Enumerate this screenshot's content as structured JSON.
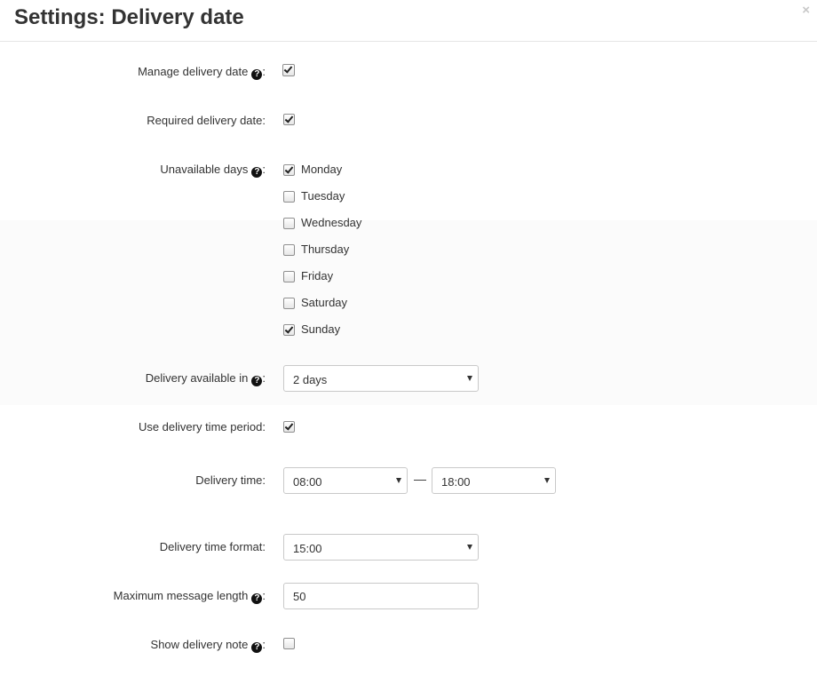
{
  "dialog": {
    "title": "Settings: Delivery date",
    "close_symbol": "×"
  },
  "help_icon_glyph": "?",
  "colon": ":",
  "fields": {
    "manage_delivery_date": {
      "label": "Manage delivery date",
      "checked": true
    },
    "required_delivery_date": {
      "label": "Required delivery date:",
      "checked": true
    },
    "unavailable_days": {
      "label": "Unavailable days",
      "days": [
        {
          "label": "Monday",
          "checked": true
        },
        {
          "label": "Tuesday",
          "checked": false
        },
        {
          "label": "Wednesday",
          "checked": false
        },
        {
          "label": "Thursday",
          "checked": false
        },
        {
          "label": "Friday",
          "checked": false
        },
        {
          "label": "Saturday",
          "checked": false
        },
        {
          "label": "Sunday",
          "checked": true
        }
      ]
    },
    "delivery_available_in": {
      "label": "Delivery available in",
      "value": "2 days"
    },
    "use_delivery_time_period": {
      "label": "Use delivery time period:",
      "checked": true
    },
    "delivery_time": {
      "label": "Delivery time:",
      "from": "08:00",
      "separator": "—",
      "to": "18:00"
    },
    "delivery_time_format": {
      "label": "Delivery time format:",
      "value": "15:00"
    },
    "maximum_message_length": {
      "label": "Maximum message length",
      "value": "50"
    },
    "show_delivery_note": {
      "label": "Show delivery note",
      "checked": false
    }
  }
}
